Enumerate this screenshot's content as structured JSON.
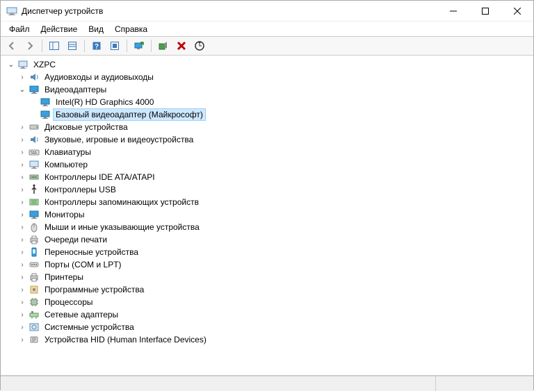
{
  "window": {
    "title": "Диспетчер устройств"
  },
  "menu": {
    "file": "Файл",
    "action": "Действие",
    "view": "Вид",
    "help": "Справка"
  },
  "tree": {
    "root": "XZPC",
    "categories": [
      {
        "label": "Аудиовходы и аудиовыходы",
        "expander": "collapsed",
        "icon": "audio"
      },
      {
        "label": "Видеоадаптеры",
        "expander": "expanded",
        "icon": "display",
        "children": [
          {
            "label": "Intel(R) HD Graphics 4000",
            "icon": "display"
          },
          {
            "label": "Базовый видеоадаптер (Майкрософт)",
            "icon": "display",
            "selected": true
          }
        ]
      },
      {
        "label": "Дисковые устройства",
        "expander": "collapsed",
        "icon": "disk"
      },
      {
        "label": "Звуковые, игровые и видеоустройства",
        "expander": "collapsed",
        "icon": "audio"
      },
      {
        "label": "Клавиатуры",
        "expander": "collapsed",
        "icon": "keyboard"
      },
      {
        "label": "Компьютер",
        "expander": "collapsed",
        "icon": "computer"
      },
      {
        "label": "Контроллеры IDE ATA/ATAPI",
        "expander": "collapsed",
        "icon": "ide"
      },
      {
        "label": "Контроллеры USB",
        "expander": "collapsed",
        "icon": "usb"
      },
      {
        "label": "Контроллеры запоминающих устройств",
        "expander": "collapsed",
        "icon": "storage"
      },
      {
        "label": "Мониторы",
        "expander": "collapsed",
        "icon": "display"
      },
      {
        "label": "Мыши и иные указывающие устройства",
        "expander": "collapsed",
        "icon": "mouse"
      },
      {
        "label": "Очереди печати",
        "expander": "collapsed",
        "icon": "printer"
      },
      {
        "label": "Переносные устройства",
        "expander": "collapsed",
        "icon": "portable"
      },
      {
        "label": "Порты (COM и LPT)",
        "expander": "collapsed",
        "icon": "port"
      },
      {
        "label": "Принтеры",
        "expander": "collapsed",
        "icon": "printer"
      },
      {
        "label": "Программные устройства",
        "expander": "collapsed",
        "icon": "software"
      },
      {
        "label": "Процессоры",
        "expander": "collapsed",
        "icon": "cpu"
      },
      {
        "label": "Сетевые адаптеры",
        "expander": "collapsed",
        "icon": "network"
      },
      {
        "label": "Системные устройства",
        "expander": "collapsed",
        "icon": "system"
      },
      {
        "label": "Устройства HID (Human Interface Devices)",
        "expander": "collapsed",
        "icon": "hid"
      }
    ]
  }
}
